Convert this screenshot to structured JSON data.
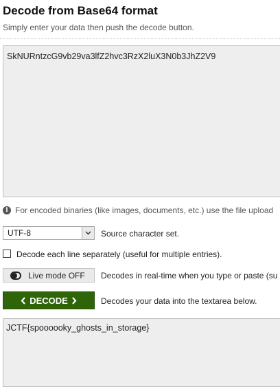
{
  "page": {
    "title": "Decode from Base64 format",
    "subtitle": "Simply enter your data then push the decode button."
  },
  "input": {
    "value": "SkNURntzcG9vb29va3lfZ2hvc3RzX2luX3N0b3JhZ2V9"
  },
  "info": {
    "text": "For encoded binaries (like images, documents, etc.) use the file upload"
  },
  "charset": {
    "selected": "UTF-8",
    "label": "Source character set."
  },
  "line_mode": {
    "label": "Decode each line separately (useful for multiple entries)."
  },
  "live_mode": {
    "button_label": "Live mode OFF",
    "description": "Decodes in real-time when you type or paste (su"
  },
  "decode": {
    "button_label": "DECODE",
    "description": "Decodes your data into the textarea below."
  },
  "output": {
    "value": "JCTF{spoooooky_ghosts_in_storage}"
  },
  "colors": {
    "accent": "#2d6508",
    "textarea_bg": "#eeeeee"
  },
  "icons": [
    "info-icon",
    "chevron-down-icon",
    "toggle-off-icon",
    "chevron-left-icon",
    "chevron-right-icon"
  ]
}
